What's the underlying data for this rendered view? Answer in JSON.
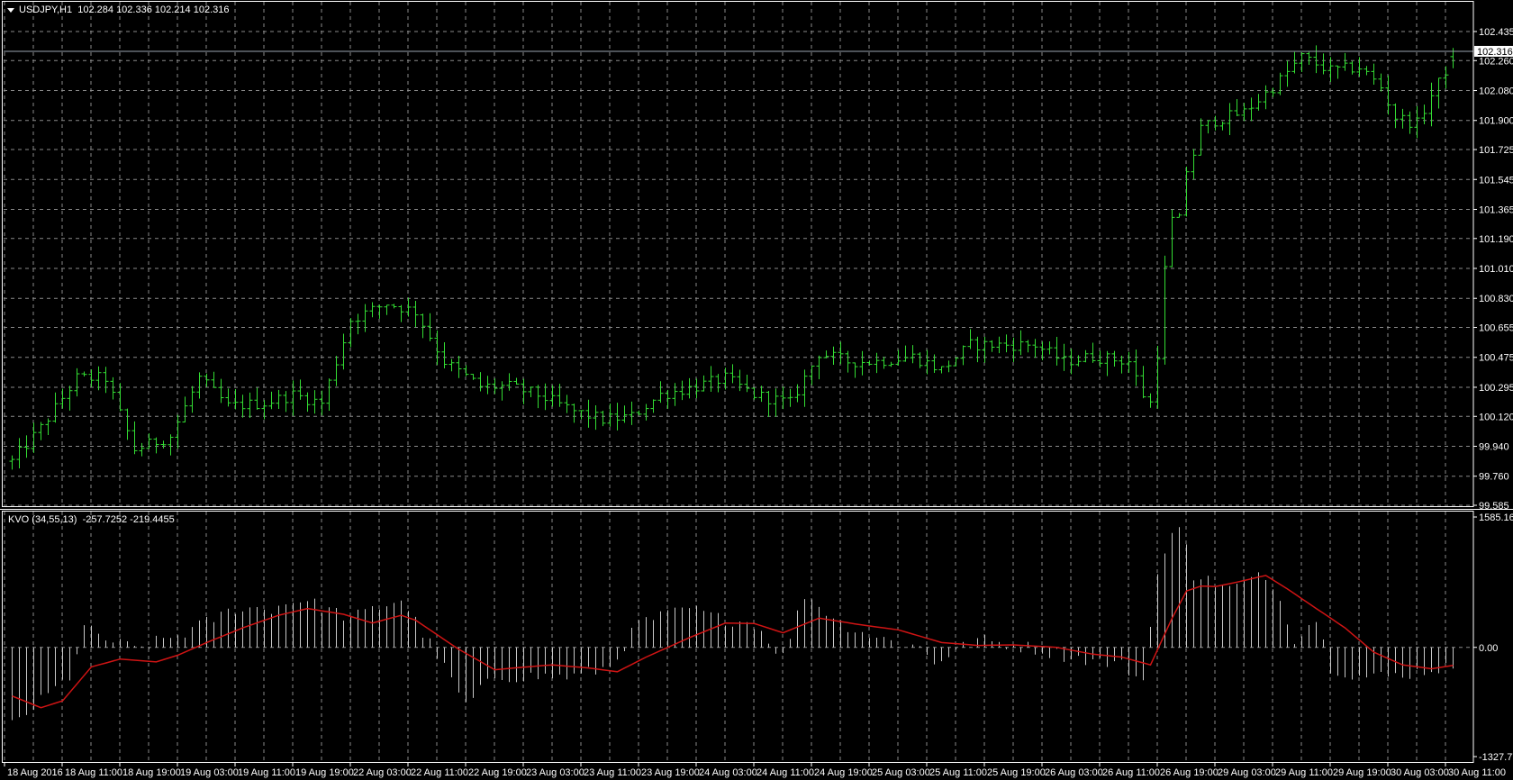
{
  "header": {
    "symbol": "USDJPY,H1",
    "open": "102.284",
    "high": "102.336",
    "low": "102.214",
    "close": "102.316"
  },
  "indicator": {
    "name": "KVO (34,55,13)",
    "value1": "-257.7252",
    "value2": "-219.4455"
  },
  "colors": {
    "background": "#000000",
    "bars": "#33dd33",
    "grid": "#8a8a8a",
    "histogram": "#c8c8c8",
    "signal": "#d01414",
    "frame": "#ffffff"
  },
  "chart_data": [
    {
      "type": "ohlc",
      "title": "USDJPY,H1",
      "bar_count": 201,
      "ylim": [
        99.585,
        102.435
      ],
      "price_ticks": [
        "102.435",
        "102.260",
        "102.080",
        "101.900",
        "101.725",
        "101.545",
        "101.365",
        "101.190",
        "101.010",
        "100.830",
        "100.655",
        "100.475",
        "100.295",
        "100.120",
        "99.940",
        "99.760",
        "99.585"
      ],
      "current_price": "102.316",
      "x_ticks": [
        "18 Aug 2016",
        "18 Aug 11:00",
        "18 Aug 19:00",
        "19 Aug 03:00",
        "19 Aug 11:00",
        "19 Aug 19:00",
        "22 Aug 03:00",
        "22 Aug 11:00",
        "22 Aug 19:00",
        "23 Aug 03:00",
        "23 Aug 11:00",
        "23 Aug 19:00",
        "24 Aug 03:00",
        "24 Aug 11:00",
        "24 Aug 19:00",
        "25 Aug 03:00",
        "25 Aug 11:00",
        "25 Aug 19:00",
        "26 Aug 03:00",
        "26 Aug 11:00",
        "26 Aug 19:00",
        "29 Aug 03:00",
        "29 Aug 11:00",
        "29 Aug 19:00",
        "30 Aug 03:00",
        "30 Aug 11:00"
      ],
      "x_tick_every_bars": 8,
      "close_by_bar": [
        [
          0,
          99.85
        ],
        [
          4,
          100.05
        ],
        [
          9,
          100.35
        ],
        [
          13,
          100.35
        ],
        [
          17,
          99.92
        ],
        [
          22,
          100.0
        ],
        [
          26,
          100.35
        ],
        [
          30,
          100.18
        ],
        [
          35,
          100.2
        ],
        [
          39,
          100.25
        ],
        [
          43,
          100.2
        ],
        [
          47,
          100.7
        ],
        [
          52,
          100.8
        ],
        [
          56,
          100.75
        ],
        [
          60,
          100.45
        ],
        [
          65,
          100.3
        ],
        [
          69,
          100.3
        ],
        [
          73,
          100.25
        ],
        [
          78,
          100.15
        ],
        [
          82,
          100.1
        ],
        [
          86,
          100.12
        ],
        [
          90,
          100.25
        ],
        [
          95,
          100.3
        ],
        [
          99,
          100.35
        ],
        [
          103,
          100.25
        ],
        [
          108,
          100.2
        ],
        [
          112,
          100.5
        ],
        [
          116,
          100.45
        ],
        [
          120,
          100.45
        ],
        [
          125,
          100.48
        ],
        [
          129,
          100.4
        ],
        [
          133,
          100.55
        ],
        [
          138,
          100.55
        ],
        [
          142,
          100.55
        ],
        [
          146,
          100.45
        ],
        [
          150,
          100.48
        ],
        [
          155,
          100.45
        ],
        [
          157,
          100.25
        ],
        [
          158,
          100.2
        ],
        [
          159,
          100.5
        ],
        [
          160,
          101.0
        ],
        [
          161,
          101.3
        ],
        [
          162,
          101.3
        ],
        [
          163,
          101.6
        ],
        [
          164,
          101.7
        ],
        [
          165,
          101.85
        ],
        [
          167,
          101.9
        ],
        [
          171,
          101.95
        ],
        [
          175,
          102.1
        ],
        [
          179,
          102.28
        ],
        [
          183,
          102.2
        ],
        [
          187,
          102.22
        ],
        [
          190,
          102.1
        ],
        [
          192,
          101.92
        ],
        [
          195,
          101.88
        ],
        [
          197,
          102.05
        ],
        [
          199,
          102.2
        ],
        [
          200,
          102.316
        ]
      ]
    },
    {
      "type": "bar+line",
      "title": "KVO (34,55,13)",
      "ylim": [
        -1327.779,
        1585.169
      ],
      "y_ticks": [
        "1585.169",
        "0.00",
        "-1327.779"
      ],
      "kvo_by_bar": [
        [
          0,
          -946
        ],
        [
          2,
          -800
        ],
        [
          8,
          -355
        ],
        [
          10,
          237
        ],
        [
          13,
          100
        ],
        [
          17,
          -20
        ],
        [
          24,
          177
        ],
        [
          31,
          473
        ],
        [
          36,
          473
        ],
        [
          40,
          592
        ],
        [
          47,
          355
        ],
        [
          54,
          592
        ],
        [
          59,
          -95
        ],
        [
          63,
          -710
        ],
        [
          67,
          -355
        ],
        [
          72,
          -355
        ],
        [
          78,
          -355
        ],
        [
          83,
          -237
        ],
        [
          87,
          296
        ],
        [
          94,
          473
        ],
        [
          98,
          355
        ],
        [
          103,
          296
        ],
        [
          107,
          -118
        ],
        [
          110,
          650
        ],
        [
          115,
          296
        ],
        [
          120,
          118
        ],
        [
          126,
          0
        ],
        [
          128,
          -177
        ],
        [
          134,
          96
        ],
        [
          141,
          0
        ],
        [
          147,
          -118
        ],
        [
          154,
          -213
        ],
        [
          157,
          -414
        ],
        [
          158.6,
          769
        ],
        [
          160.6,
          1300
        ],
        [
          162.6,
          1480
        ],
        [
          164,
          887
        ],
        [
          169,
          710
        ],
        [
          173,
          852
        ],
        [
          175,
          780
        ],
        [
          178,
          118
        ],
        [
          181,
          355
        ],
        [
          183,
          -237
        ],
        [
          187,
          -355
        ],
        [
          191,
          -355
        ],
        [
          195,
          -300
        ],
        [
          199,
          -237
        ],
        [
          200,
          -257.7252
        ]
      ],
      "signal_by_bar": [
        [
          0,
          -592
        ],
        [
          4,
          -733
        ],
        [
          7,
          -650
        ],
        [
          11,
          -237
        ],
        [
          15,
          -142
        ],
        [
          20,
          -177
        ],
        [
          23,
          -95
        ],
        [
          27,
          59
        ],
        [
          32,
          237
        ],
        [
          37,
          390
        ],
        [
          41,
          473
        ],
        [
          46,
          402
        ],
        [
          50,
          296
        ],
        [
          54,
          390
        ],
        [
          56,
          330
        ],
        [
          62,
          -24
        ],
        [
          67,
          -272
        ],
        [
          71,
          -240
        ],
        [
          75,
          -213
        ],
        [
          80,
          -250
        ],
        [
          84,
          -296
        ],
        [
          88,
          -118
        ],
        [
          94,
          118
        ],
        [
          99,
          296
        ],
        [
          103,
          290
        ],
        [
          107,
          177
        ],
        [
          112,
          355
        ],
        [
          118,
          272
        ],
        [
          123,
          213
        ],
        [
          129,
          59
        ],
        [
          134,
          24
        ],
        [
          139,
          30
        ],
        [
          145,
          0
        ],
        [
          150,
          -83
        ],
        [
          154,
          -118
        ],
        [
          158,
          -213
        ],
        [
          161,
          355
        ],
        [
          163,
          686
        ],
        [
          165,
          745
        ],
        [
          167,
          740
        ],
        [
          170,
          793
        ],
        [
          174,
          875
        ],
        [
          177,
          710
        ],
        [
          181,
          473
        ],
        [
          185,
          237
        ],
        [
          189,
          -59
        ],
        [
          193,
          -213
        ],
        [
          197,
          -260
        ],
        [
          200,
          -219.4455
        ]
      ]
    }
  ]
}
